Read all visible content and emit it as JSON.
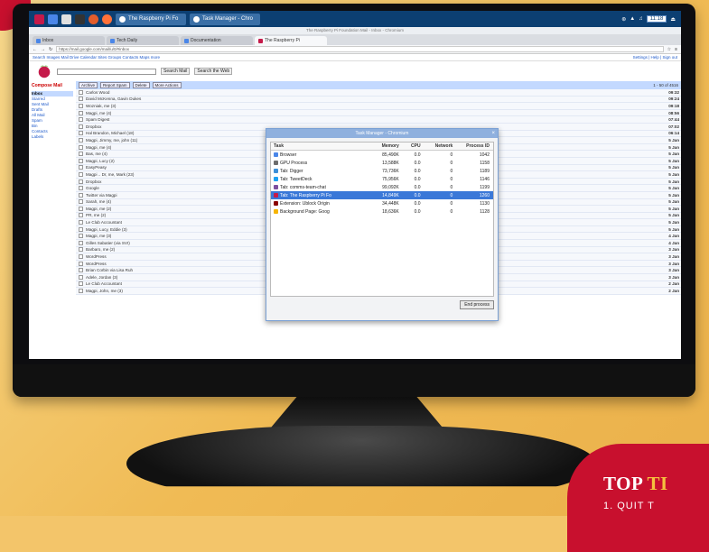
{
  "taskbar": {
    "tasks": [
      "The Raspberry Pi Fo",
      "Task Manager - Chro"
    ],
    "clock": "11:18"
  },
  "browser": {
    "window_title": "The Raspberry Pi Foundation Mail - Inbox - Chromium",
    "tabs": [
      "Inbox",
      "Tech Daily",
      "Documentation",
      "The Raspberry Pi"
    ],
    "url": "https://mail.google.com/mail/u/0/#inbox",
    "gbar_links": "Search Images Mail Drive Calendar Sites Groups Contacts Maps more",
    "gbar_account": "Settings | Help | Sign out"
  },
  "gmail": {
    "search_button": "Search Mail",
    "search_web_button": "Search the Web",
    "left_title": "Compose Mail",
    "folders": [
      "Inbox",
      "Starred",
      "Sent Mail",
      "Drafts",
      "All Mail",
      "Spam",
      "Bin",
      "Contacts",
      "Labels"
    ],
    "action_buttons": [
      "Archive",
      "Report Spam",
      "Delete",
      "More Actions"
    ],
    "pager": "1 - 50 of 4516",
    "emails": [
      {
        "from": "Carlos Wood",
        "subject": "",
        "date": "09:32"
      },
      {
        "from": "David McKenna, Gavin Dukes",
        "subject": "",
        "date": "09:24"
      },
      {
        "from": "Wozniak, me (3)",
        "subject": "",
        "date": "09:18"
      },
      {
        "from": "Magpi, me (4)",
        "subject": "",
        "date": "08:56"
      },
      {
        "from": "Spam Digest",
        "subject": "",
        "date": "07:44"
      },
      {
        "from": "Dropbox",
        "subject": "",
        "date": "07:02"
      },
      {
        "from": "Hal Brandon, Michael (18)",
        "subject": "",
        "date": "06:14"
      },
      {
        "from": "Magpi, Jimmy, me, john (11)",
        "subject": "",
        "date": "5 Jan"
      },
      {
        "from": "Magpi, me (4)",
        "subject": "",
        "date": "5 Jan"
      },
      {
        "from": "Bas, me (4)",
        "subject": "",
        "date": "5 Jan"
      },
      {
        "from": "Magpi, Lucy (2)",
        "subject": "",
        "date": "5 Jan"
      },
      {
        "from": "EasyPeasy",
        "subject": "",
        "date": "5 Jan"
      },
      {
        "from": "Magpi .. Dr, me, Mark (23)",
        "subject": "",
        "date": "5 Jan"
      },
      {
        "from": "Dropbox",
        "subject": "",
        "date": "5 Jan"
      },
      {
        "from": "Google",
        "subject": "",
        "date": "5 Jan"
      },
      {
        "from": "Twitter via Magpi",
        "subject": "",
        "date": "5 Jan"
      },
      {
        "from": "Sarah, me (4)",
        "subject": "",
        "date": "5 Jan"
      },
      {
        "from": "Magpi, me (2)",
        "subject": "",
        "date": "5 Jan"
      },
      {
        "from": "PR, me (2)",
        "subject": "",
        "date": "5 Jan"
      },
      {
        "from": "Le Club Accountant",
        "subject": "",
        "date": "5 Jan"
      },
      {
        "from": "Magpi, Lucy, Eddie (3)",
        "subject": "",
        "date": "5 Jan"
      },
      {
        "from": "Magpi, me (3)",
        "subject": "",
        "date": "4 Jan"
      },
      {
        "from": "Gilles Sabatier (via SVI)",
        "subject": "",
        "date": "4 Jan"
      },
      {
        "from": "Barbaro, me (2)",
        "subject": "",
        "date": "3 Jan"
      },
      {
        "from": "WordPress",
        "subject": "",
        "date": "3 Jan"
      },
      {
        "from": "WordPress",
        "subject": "",
        "date": "3 Jan"
      },
      {
        "from": "Brian Corbin via Lisa Ruh",
        "subject": "",
        "date": "3 Jan"
      },
      {
        "from": "Adele, Jordan (3)",
        "subject": "",
        "date": "3 Jan"
      },
      {
        "from": "Le Club Accountant",
        "subject": "",
        "date": "2 Jan"
      },
      {
        "from": "Magpi, John, me (3)",
        "subject": "",
        "date": "2 Jan"
      }
    ]
  },
  "task_manager": {
    "title": "Task Manager - Chromium",
    "columns": [
      "Task",
      "Memory",
      "CPU",
      "Network",
      "Process ID"
    ],
    "rows": [
      {
        "task": "Browser",
        "memory": "85,490K",
        "cpu": "0.0",
        "network": "0",
        "pid": "1042",
        "icon_color": "#4a86e8"
      },
      {
        "task": "GPU Process",
        "memory": "13,588K",
        "cpu": "0.0",
        "network": "0",
        "pid": "1158",
        "icon_color": "#6d6d6d"
      },
      {
        "task": "Tab: Digger",
        "memory": "73,736K",
        "cpu": "0.0",
        "network": "0",
        "pid": "1189",
        "icon_color": "#3c8fd8"
      },
      {
        "task": "Tab: TweetDeck",
        "memory": "75,956K",
        "cpu": "0.0",
        "network": "0",
        "pid": "1146",
        "icon_color": "#1da1f2"
      },
      {
        "task": "Tab: comms-team-chat",
        "memory": "99,092K",
        "cpu": "0.0",
        "network": "0",
        "pid": "1199",
        "icon_color": "#7c4fa0"
      },
      {
        "task": "Tab: The Raspberry Pi Fo",
        "memory": "14,849K",
        "cpu": "0.0",
        "network": "0",
        "pid": "1260",
        "icon_color": "#c51a4a"
      },
      {
        "task": "Extension: Ublock Origin",
        "memory": "34,448K",
        "cpu": "0.0",
        "network": "0",
        "pid": "1130",
        "icon_color": "#8b0000"
      },
      {
        "task": "Background Page: Goog",
        "memory": "18,636K",
        "cpu": "0.0",
        "network": "0",
        "pid": "1128",
        "icon_color": "#f6b400"
      }
    ],
    "selected_index": 5,
    "end_process_label": "End process"
  },
  "banner": {
    "title_part1": "TOP ",
    "title_part2": "TI",
    "subtitle": "1. QUIT T"
  }
}
